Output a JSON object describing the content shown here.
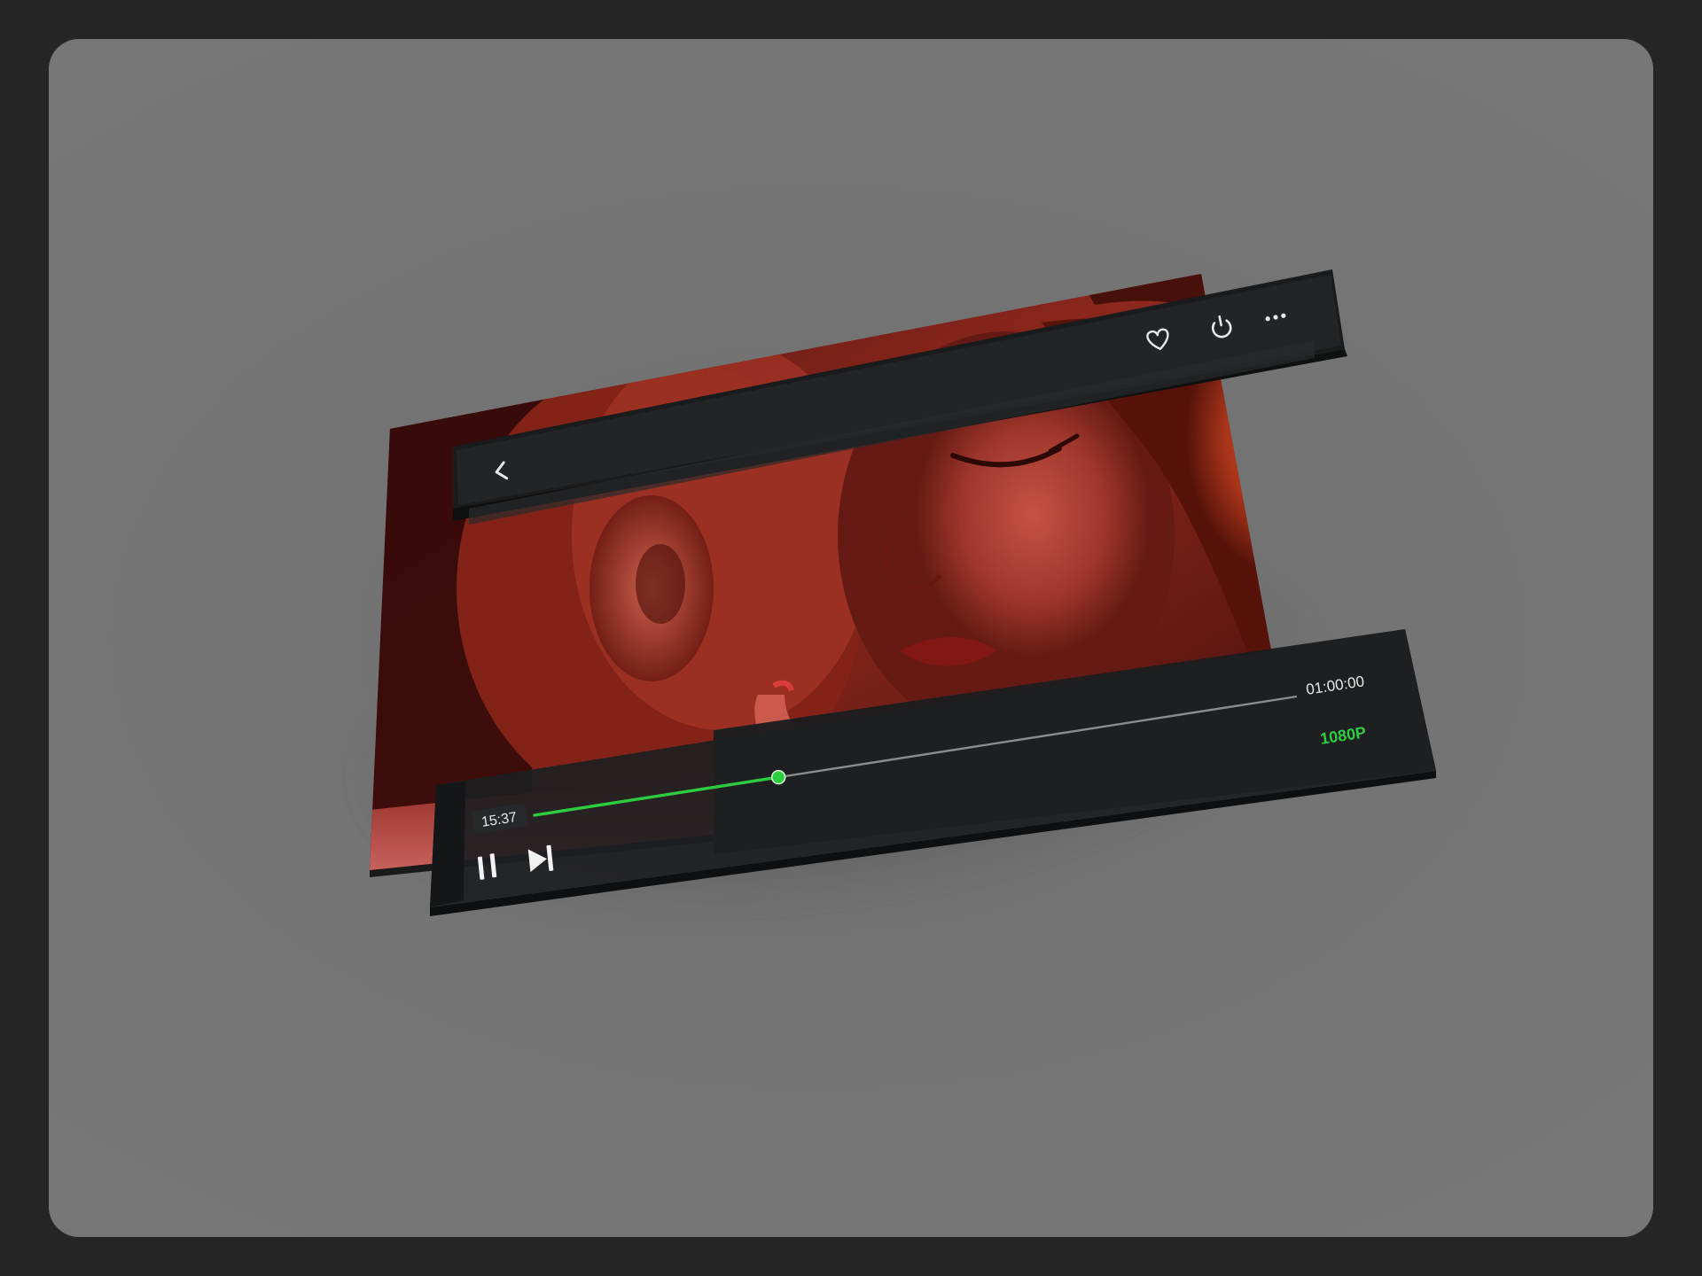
{
  "player": {
    "current_time": "15:37",
    "total_time": "01:00:00",
    "quality": "1080P",
    "progress": 0.32,
    "icons": {
      "back": "chevron-left-icon",
      "favorite": "heart-icon",
      "power": "power-icon",
      "more": "more-horizontal-icon",
      "pause": "pause-icon",
      "next": "skip-next-icon"
    },
    "colors": {
      "accent": "#2ecc40",
      "bar": "#1f2123",
      "text": "#e8e8e8"
    }
  }
}
